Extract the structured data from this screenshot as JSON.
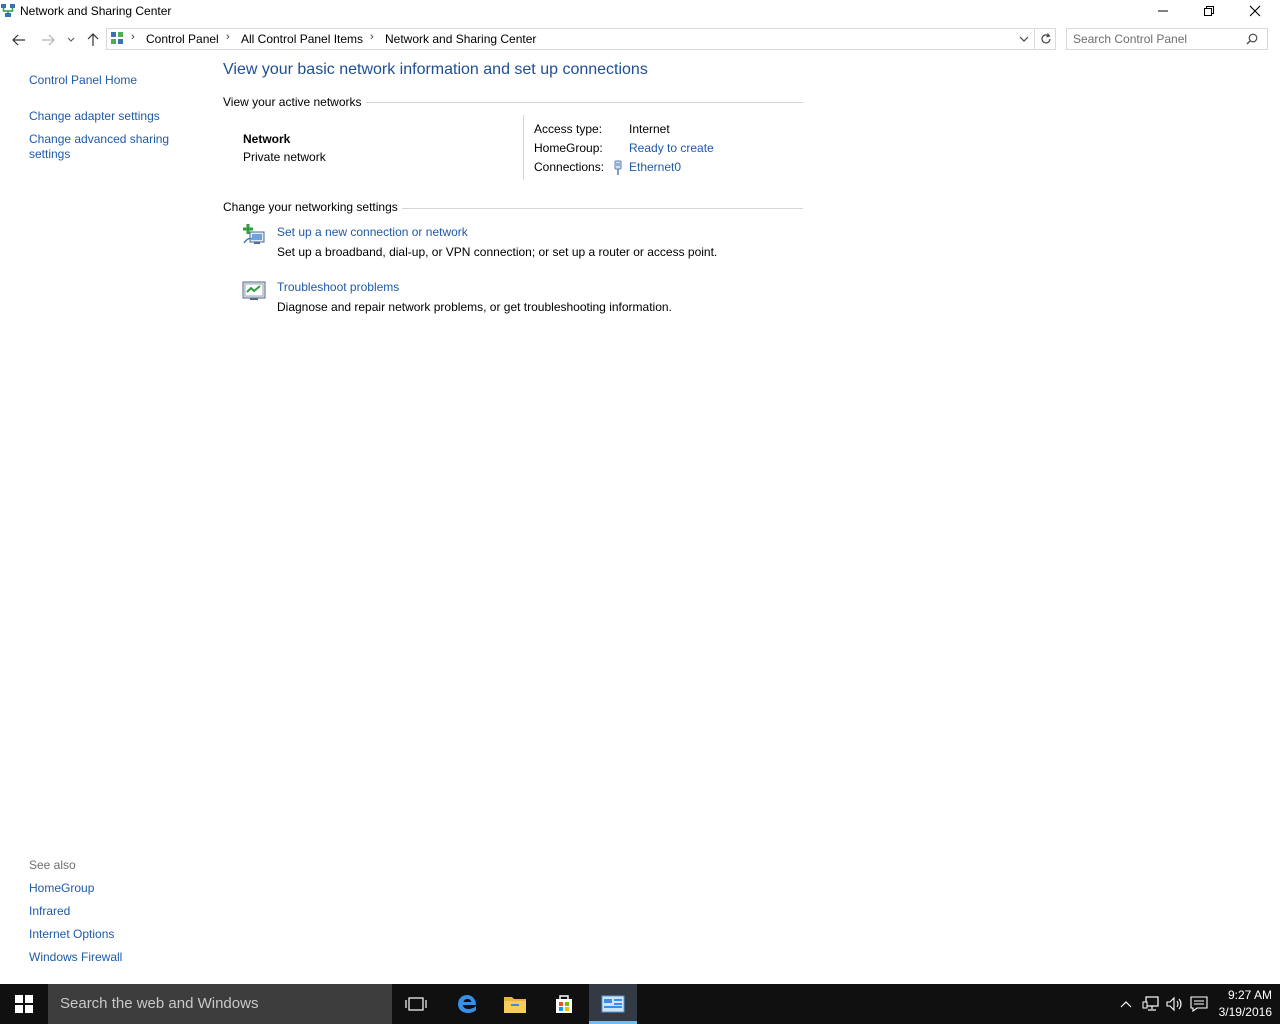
{
  "window": {
    "title": "Network and Sharing Center"
  },
  "address": {
    "crumbs": [
      "Control Panel",
      "All Control Panel Items",
      "Network and Sharing Center"
    ]
  },
  "search": {
    "placeholder": "Search Control Panel"
  },
  "left_pane": {
    "home": "Control Panel Home",
    "links": [
      "Change adapter settings",
      "Change advanced sharing settings"
    ],
    "see_also_title": "See also",
    "see_also": [
      "HomeGroup",
      "Infrared",
      "Internet Options",
      "Windows Firewall"
    ]
  },
  "main": {
    "title": "View your basic network information and set up connections",
    "active_header": "View your active networks",
    "network_name": "Network",
    "network_type": "Private network",
    "access_label": "Access type:",
    "access_value": "Internet",
    "homegroup_label": "HomeGroup:",
    "homegroup_value": "Ready to create",
    "connections_label": "Connections:",
    "connections_value": "Ethernet0",
    "change_header": "Change your networking settings",
    "tasks": [
      {
        "label": "Set up a new connection or network",
        "desc": "Set up a broadband, dial-up, or VPN connection; or set up a router or access point.",
        "icon": "new-connection-icon"
      },
      {
        "label": "Troubleshoot problems",
        "desc": "Diagnose and repair network problems, or get troubleshooting information.",
        "icon": "troubleshoot-icon"
      }
    ]
  },
  "taskbar": {
    "search_text": "Search the web and Windows",
    "time": "9:27 AM",
    "date": "3/19/2016",
    "apps": [
      "task-view-icon",
      "edge-icon",
      "file-explorer-icon",
      "store-icon",
      "control-panel-icon"
    ]
  },
  "colors": {
    "link": "#1e5aa8",
    "title": "#1e4e96",
    "taskbar": "#101010",
    "active_app_accent": "#76b9ed"
  }
}
